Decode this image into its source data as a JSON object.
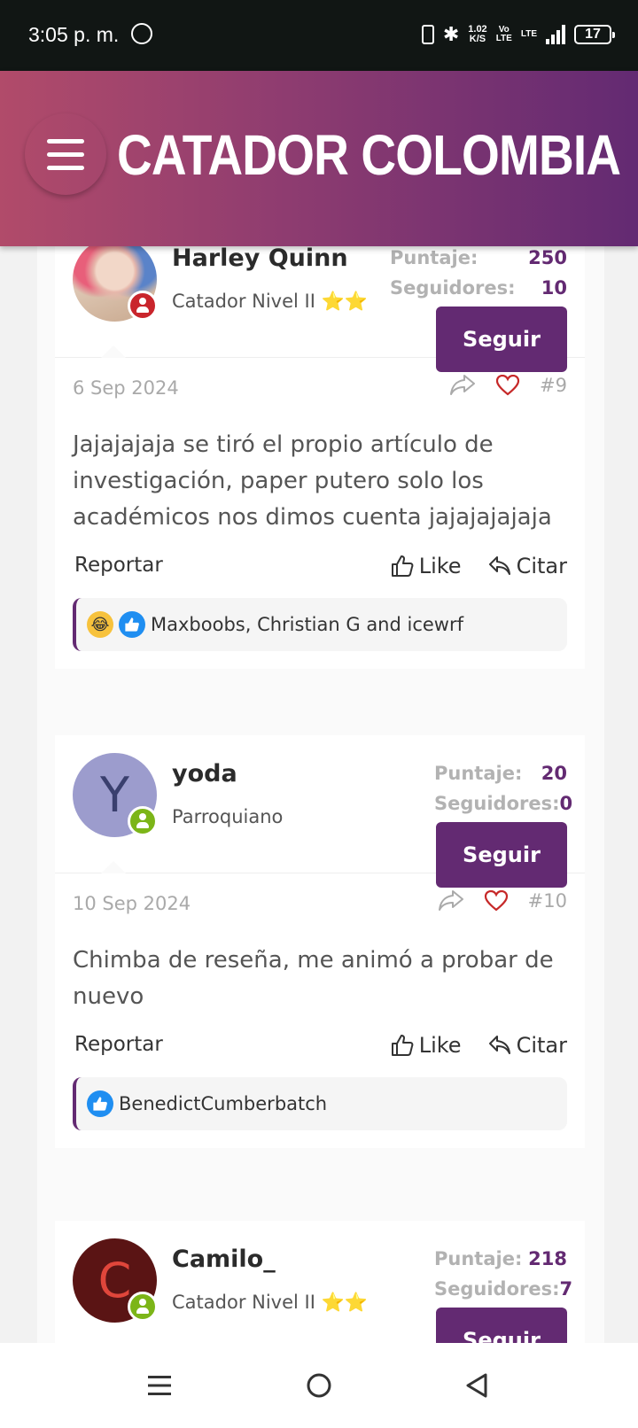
{
  "status_bar": {
    "time": "3:05 p. m.",
    "speed_value": "1.02",
    "speed_unit": "K/S",
    "volte_top": "Vo",
    "volte_bottom": "LTE",
    "lte_label": "LTE",
    "battery": "17"
  },
  "header": {
    "title": "CATADOR COLOMBIA"
  },
  "labels": {
    "score": "Puntaje:",
    "followers": "Seguidores:",
    "follow": "Seguir",
    "report": "Reportar",
    "like": "Like",
    "quote": "Citar"
  },
  "posts": [
    {
      "username": "Harley Quinn",
      "level": "Catador Nivel II",
      "stars": "⭐⭐",
      "score": "250",
      "followers": "10",
      "date": "6 Sep 2024",
      "number": "#9",
      "body": "Jajajajaja se tiró el propio artículo de investigación, paper putero solo los académicos nos dimos cuenta jajajajajaja",
      "reactions_text": "Maxboobs, Christian G and icewrf",
      "reactions": [
        "laugh-icon",
        "like-icon"
      ],
      "badge_color": "#c9252c"
    },
    {
      "username": "yoda",
      "level": "Parroquiano",
      "avatar_letter": "Y",
      "avatar_color": "#9c9ccd",
      "avatar_letter_color": "#3a3f6e",
      "score": "20",
      "followers": "0",
      "date": "10 Sep 2024",
      "number": "#10",
      "body": "Chimba de reseña, me animó a probar de nuevo",
      "reactions_text": "BenedictCumberbatch",
      "reactions": [
        "like-icon"
      ],
      "badge_color": "#7cb518"
    },
    {
      "username": "Camilo_",
      "level": "Catador Nivel II",
      "stars": "⭐⭐",
      "avatar_letter": "C",
      "avatar_color": "#5a1414",
      "avatar_letter_color": "#e0463b",
      "score": "218",
      "followers": "7",
      "badge_color": "#7cb518"
    }
  ],
  "colors": {
    "accent": "#632a72",
    "heart": "#c62828"
  }
}
